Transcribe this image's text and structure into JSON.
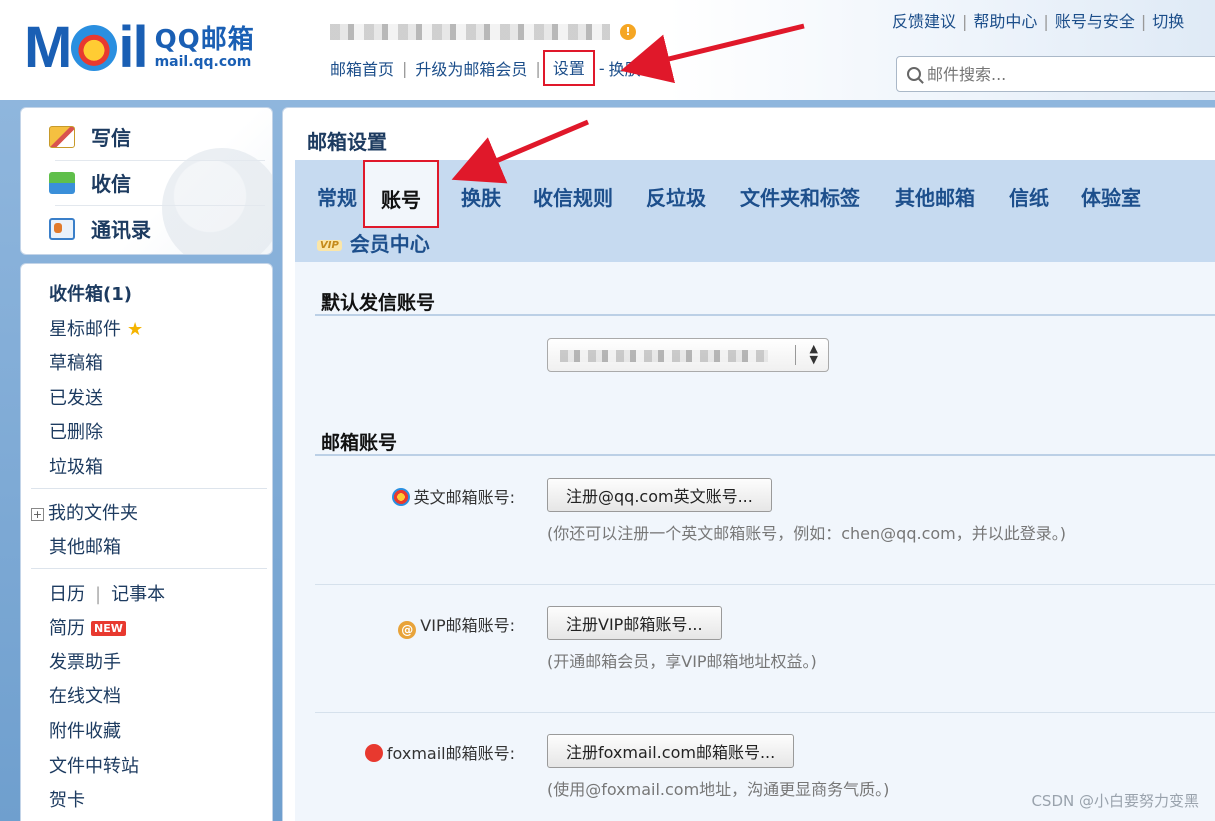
{
  "header": {
    "logo_mail": "M",
    "logo_mail_rest": "il",
    "logo_qq": "QQ邮箱",
    "logo_domain": "mail.qq.com",
    "warn": "!",
    "nav": {
      "home": "邮箱首页",
      "upgrade": "升级为邮箱会员",
      "settings": "设置",
      "dash": "-",
      "skin": "换肤"
    },
    "links": {
      "feedback": "反馈建议",
      "help": "帮助中心",
      "security": "账号与安全",
      "switch": "切换"
    },
    "search_placeholder": "邮件搜索..."
  },
  "quick": {
    "compose": "写信",
    "receive": "收信",
    "contacts": "通讯录"
  },
  "sidebar": {
    "inbox": "收件箱(1)",
    "starred": "星标邮件",
    "drafts": "草稿箱",
    "sent": "已发送",
    "deleted": "已删除",
    "spam": "垃圾箱",
    "my_folders": "我的文件夹",
    "other_mail": "其他邮箱",
    "calendar": "日历",
    "notes": "记事本",
    "resume": "简历",
    "new_badge": "NEW",
    "invoice": "发票助手",
    "docs": "在线文档",
    "attachments": "附件收藏",
    "transfer": "文件中转站",
    "cards": "贺卡"
  },
  "main": {
    "title": "邮箱设置",
    "tabs": [
      "常规",
      "账号",
      "换肤",
      "收信规则",
      "反垃圾",
      "文件夹和标签",
      "其他邮箱",
      "信纸",
      "体验室"
    ],
    "vip_tag": "VIP",
    "member_tab": "会员中心",
    "active_tab": "账号",
    "section_default": "默认发信账号",
    "section_accounts": "邮箱账号",
    "rows": [
      {
        "label": "英文邮箱账号:",
        "button": "注册@qq.com英文账号...",
        "hint": "(你还可以注册一个英文邮箱账号，例如：chen@qq.com，并以此登录。)"
      },
      {
        "label": "VIP邮箱账号:",
        "button": "注册VIP邮箱账号...",
        "hint": "(开通邮箱会员，享VIP邮箱地址权益。)"
      },
      {
        "label": "foxmail邮箱账号:",
        "button": "注册foxmail.com邮箱账号...",
        "hint": "(使用@foxmail.com地址，沟通更显商务气质。)"
      }
    ]
  },
  "watermark": "CSDN @小白要努力变黑",
  "colors": {
    "accent": "#1d4f8c",
    "highlight": "#e0182a",
    "tabbar": "#c6daf0"
  }
}
